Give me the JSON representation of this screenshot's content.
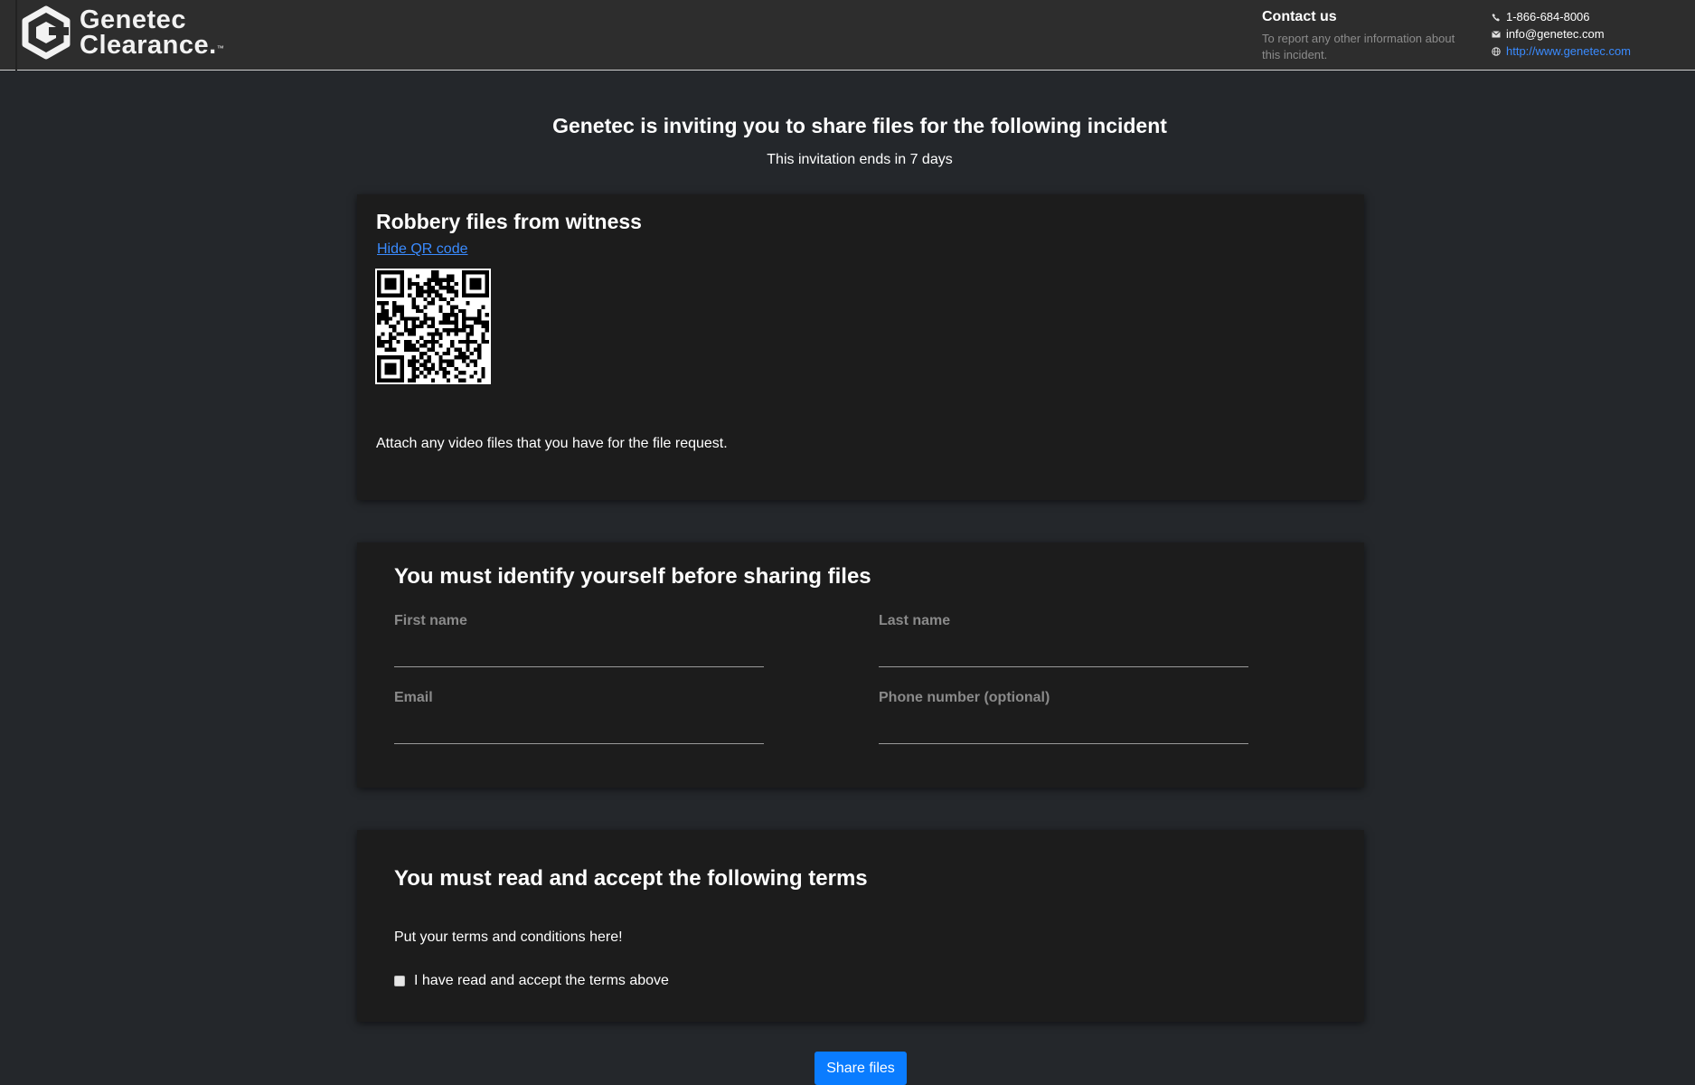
{
  "brand": {
    "line1": "Genetec",
    "line2": "Clearance.",
    "tm": "™",
    "logo_icon": "genetec-logo-icon"
  },
  "contact": {
    "title": "Contact us",
    "description": "To report any other information about this incident.",
    "phone": "1-866-684-8006",
    "email": "info@genetec.com",
    "website": "http://www.genetec.com",
    "icons": [
      "phone-icon",
      "mail-icon",
      "globe-icon"
    ]
  },
  "intro": {
    "title": "Genetec is inviting you to share files for the following incident",
    "subtitle": "This invitation ends in 7 days"
  },
  "incident": {
    "title": "Robbery files from witness",
    "qr_toggle_label": "Hide QR code",
    "description": "Attach any video files that you have for the file request."
  },
  "identify": {
    "title": "You must identify yourself before sharing files",
    "fields": {
      "first_name": {
        "label": "First name",
        "value": ""
      },
      "last_name": {
        "label": "Last name",
        "value": ""
      },
      "email": {
        "label": "Email",
        "value": ""
      },
      "phone": {
        "label": "Phone number (optional)",
        "value": ""
      }
    }
  },
  "terms": {
    "title": "You must read and accept the following terms",
    "text": "Put your terms and conditions here!",
    "accept_label": "I have read and accept the terms above",
    "accepted": false
  },
  "actions": {
    "share_label": "Share files"
  },
  "colors": {
    "accent": "#0a7cff",
    "link": "#3a8bff",
    "background": "#24272b",
    "card": "#1c1c1c",
    "header": "#2d2d2d"
  }
}
